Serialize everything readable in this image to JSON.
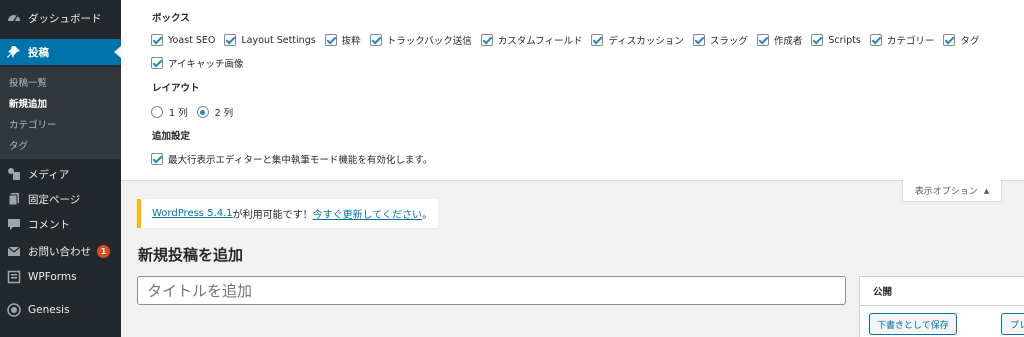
{
  "sidebar": {
    "dashboard": {
      "label": "ダッシュボード",
      "icon": "dashboard-icon"
    },
    "posts": {
      "label": "投稿",
      "icon": "pin-icon"
    },
    "submenu": [
      {
        "label": "投稿一覧"
      },
      {
        "label": "新規追加"
      },
      {
        "label": "カテゴリー"
      },
      {
        "label": "タグ"
      }
    ],
    "media": {
      "label": "メディア",
      "icon": "media-icon"
    },
    "pages": {
      "label": "固定ページ",
      "icon": "page-icon"
    },
    "comments": {
      "label": "コメント",
      "icon": "comment-icon"
    },
    "contact": {
      "label": "お問い合わせ",
      "icon": "mail-icon",
      "badge": "1"
    },
    "wpforms": {
      "label": "WPForms",
      "icon": "wpforms-icon"
    },
    "genesis": {
      "label": "Genesis",
      "icon": "genesis-icon"
    }
  },
  "screen_options": {
    "boxes_heading": "ボックス",
    "boxes": [
      {
        "label": "Yoast SEO",
        "checked": true
      },
      {
        "label": "Layout Settings",
        "checked": true
      },
      {
        "label": "抜粋",
        "checked": true
      },
      {
        "label": "トラックバック送信",
        "checked": true
      },
      {
        "label": "カスタムフィールド",
        "checked": true
      },
      {
        "label": "ディスカッション",
        "checked": true
      },
      {
        "label": "スラッグ",
        "checked": true
      },
      {
        "label": "作成者",
        "checked": true
      },
      {
        "label": "Scripts",
        "checked": true
      },
      {
        "label": "カテゴリー",
        "checked": true
      },
      {
        "label": "タグ",
        "checked": true
      },
      {
        "label": "アイキャッチ画像",
        "checked": true
      }
    ],
    "layout_heading": "レイアウト",
    "layout_options": [
      {
        "label": "1 列",
        "checked": false
      },
      {
        "label": "2 列",
        "checked": true
      }
    ],
    "additional_heading": "追加設定",
    "additional_option": {
      "label": "最大行表示エディターと集中執筆モード機能を有効化します。",
      "checked": true
    },
    "tab_label": "表示オプション",
    "tab_arrow": "▲"
  },
  "notice": {
    "link1": "WordPress 5.4.1",
    "middle": " が利用可能です！",
    "link2": "今すぐ更新してください",
    "end": "。"
  },
  "page_title": "新規投稿を追加",
  "title_input": {
    "placeholder": "タイトルを追加"
  },
  "publish": {
    "heading": "公開",
    "save_draft": "下書きとして保存",
    "preview": "プレビュー"
  },
  "colors": {
    "sidebar_bg": "#23282d",
    "active_bg": "#0073aa",
    "notice_border": "#ffb900",
    "badge": "#d54e21",
    "link": "#0073aa"
  }
}
